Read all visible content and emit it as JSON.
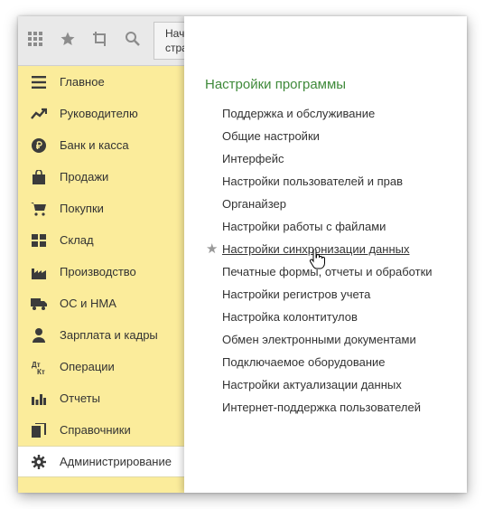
{
  "toolbar": {
    "icons": [
      "apps-grid-icon",
      "star-icon",
      "history-icon",
      "search-icon"
    ],
    "tab_stub_line1": "Нач",
    "tab_stub_line2": "стра"
  },
  "sidebar": {
    "items": [
      {
        "label": "Главное",
        "icon": "menu-icon"
      },
      {
        "label": "Руководителю",
        "icon": "trend-icon"
      },
      {
        "label": "Банк и касса",
        "icon": "ruble-icon"
      },
      {
        "label": "Продажи",
        "icon": "bag-icon"
      },
      {
        "label": "Покупки",
        "icon": "cart-icon"
      },
      {
        "label": "Склад",
        "icon": "warehouse-icon"
      },
      {
        "label": "Производство",
        "icon": "factory-icon"
      },
      {
        "label": "ОС и НМА",
        "icon": "truck-icon"
      },
      {
        "label": "Зарплата и кадры",
        "icon": "person-icon"
      },
      {
        "label": "Операции",
        "icon": "dt-kt-icon"
      },
      {
        "label": "Отчеты",
        "icon": "bar-chart-icon"
      },
      {
        "label": "Справочники",
        "icon": "books-icon"
      },
      {
        "label": "Администрирование",
        "icon": "gear-icon",
        "active": true
      }
    ]
  },
  "panel": {
    "title": "Настройки программы",
    "links": [
      "Поддержка и обслуживание",
      "Общие настройки",
      "Интерфейс",
      "Настройки пользователей и прав",
      "Органайзер",
      "Настройки работы с файлами",
      "Настройки синхронизации данных",
      "Печатные формы, отчеты и обработки",
      "Настройки регистров учета",
      "Настройка колонтитулов",
      "Обмен электронными документами",
      "Подключаемое оборудование",
      "Настройки актуализации данных",
      "Интернет-поддержка пользователей"
    ],
    "hovered_index": 6
  },
  "colors": {
    "sidebar_bg": "#fbec9b",
    "title_green": "#3f8a3a",
    "text": "#333333"
  }
}
